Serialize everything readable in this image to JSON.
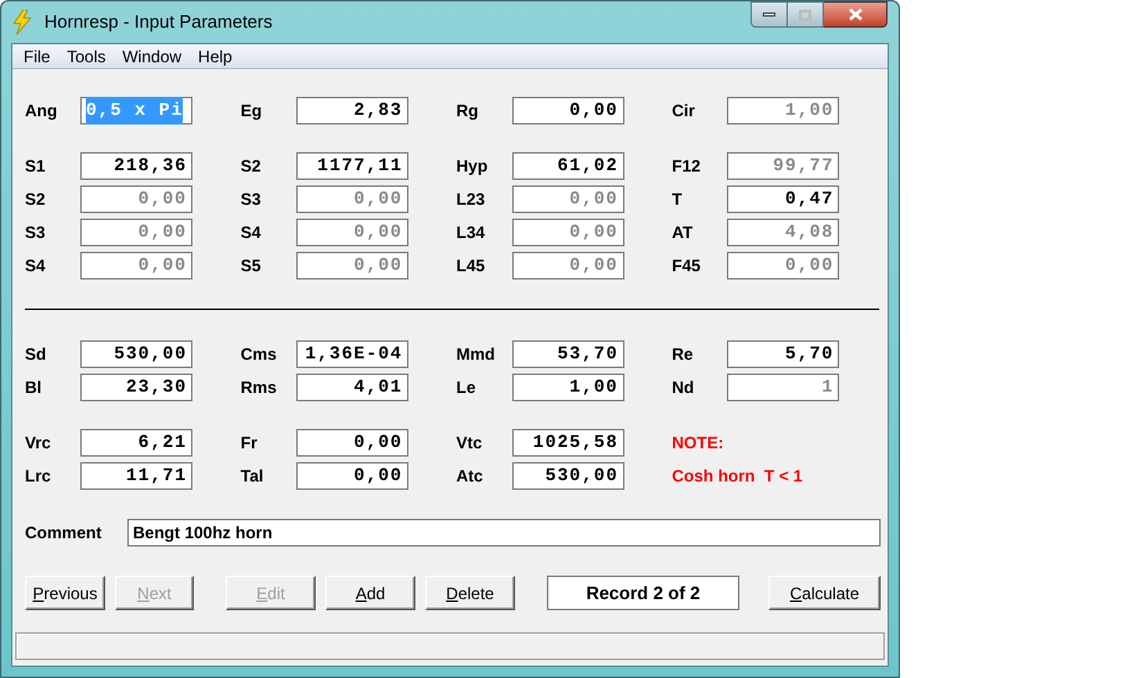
{
  "window": {
    "title": "Hornresp - Input Parameters"
  },
  "menu": [
    "File",
    "Tools",
    "Window",
    "Help"
  ],
  "blocks": [
    {
      "divider_before": false,
      "rows": [
        [
          {
            "kind": "field",
            "label": "Ang",
            "value": "0,5 x Pi",
            "disabled": false,
            "highlighted": true
          },
          {
            "kind": "field",
            "label": "Eg",
            "value": "2,83",
            "disabled": false,
            "highlighted": false
          },
          {
            "kind": "field",
            "label": "Rg",
            "value": "0,00",
            "disabled": false,
            "highlighted": false
          },
          {
            "kind": "field",
            "label": "Cir",
            "value": "1,00",
            "disabled": true,
            "highlighted": false
          }
        ]
      ]
    },
    {
      "divider_before": false,
      "rows": [
        [
          {
            "kind": "field",
            "label": "S1",
            "value": "218,36",
            "disabled": false,
            "highlighted": false
          },
          {
            "kind": "field",
            "label": "S2",
            "value": "1177,11",
            "disabled": false,
            "highlighted": false
          },
          {
            "kind": "field",
            "label": "Hyp",
            "value": "61,02",
            "disabled": false,
            "highlighted": false
          },
          {
            "kind": "field",
            "label": "F12",
            "value": "99,77",
            "disabled": true,
            "highlighted": false
          }
        ],
        [
          {
            "kind": "field",
            "label": "S2",
            "value": "0,00",
            "disabled": true,
            "highlighted": false
          },
          {
            "kind": "field",
            "label": "S3",
            "value": "0,00",
            "disabled": true,
            "highlighted": false
          },
          {
            "kind": "field",
            "label": "L23",
            "value": "0,00",
            "disabled": true,
            "highlighted": false
          },
          {
            "kind": "field",
            "label": "T",
            "value": "0,47",
            "disabled": false,
            "highlighted": false
          }
        ],
        [
          {
            "kind": "field",
            "label": "S3",
            "value": "0,00",
            "disabled": true,
            "highlighted": false
          },
          {
            "kind": "field",
            "label": "S4",
            "value": "0,00",
            "disabled": true,
            "highlighted": false
          },
          {
            "kind": "field",
            "label": "L34",
            "value": "0,00",
            "disabled": true,
            "highlighted": false
          },
          {
            "kind": "field",
            "label": "AT",
            "value": "4,08",
            "disabled": true,
            "highlighted": false
          }
        ],
        [
          {
            "kind": "field",
            "label": "S4",
            "value": "0,00",
            "disabled": true,
            "highlighted": false
          },
          {
            "kind": "field",
            "label": "S5",
            "value": "0,00",
            "disabled": true,
            "highlighted": false
          },
          {
            "kind": "field",
            "label": "L45",
            "value": "0,00",
            "disabled": true,
            "highlighted": false
          },
          {
            "kind": "field",
            "label": "F45",
            "value": "0,00",
            "disabled": true,
            "highlighted": false
          }
        ]
      ]
    },
    {
      "divider_before": true,
      "rows": [
        [
          {
            "kind": "field",
            "label": "Sd",
            "value": "530,00",
            "disabled": false,
            "highlighted": false
          },
          {
            "kind": "field",
            "label": "Cms",
            "value": "1,36E-04",
            "disabled": false,
            "highlighted": false
          },
          {
            "kind": "field",
            "label": "Mmd",
            "value": "53,70",
            "disabled": false,
            "highlighted": false
          },
          {
            "kind": "field",
            "label": "Re",
            "value": "5,70",
            "disabled": false,
            "highlighted": false
          }
        ],
        [
          {
            "kind": "field",
            "label": "Bl",
            "value": "23,30",
            "disabled": false,
            "highlighted": false
          },
          {
            "kind": "field",
            "label": "Rms",
            "value": "4,01",
            "disabled": false,
            "highlighted": false
          },
          {
            "kind": "field",
            "label": "Le",
            "value": "1,00",
            "disabled": false,
            "highlighted": false
          },
          {
            "kind": "field",
            "label": "Nd",
            "value": "1",
            "disabled": true,
            "highlighted": false
          }
        ]
      ]
    },
    {
      "divider_before": false,
      "rows": [
        [
          {
            "kind": "field",
            "label": "Vrc",
            "value": "6,21",
            "disabled": false,
            "highlighted": false
          },
          {
            "kind": "field",
            "label": "Fr",
            "value": "0,00",
            "disabled": false,
            "highlighted": false
          },
          {
            "kind": "field",
            "label": "Vtc",
            "value": "1025,58",
            "disabled": false,
            "highlighted": false
          },
          {
            "kind": "note",
            "label": "NOTE:"
          }
        ],
        [
          {
            "kind": "field",
            "label": "Lrc",
            "value": "11,71",
            "disabled": false,
            "highlighted": false
          },
          {
            "kind": "field",
            "label": "Tal",
            "value": "0,00",
            "disabled": false,
            "highlighted": false
          },
          {
            "kind": "field",
            "label": "Atc",
            "value": "530,00",
            "disabled": false,
            "highlighted": false
          },
          {
            "kind": "note",
            "label": "Cosh horn  T < 1"
          }
        ]
      ]
    }
  ],
  "comment": {
    "label": "Comment",
    "value": "Bengt 100hz horn"
  },
  "buttons": [
    {
      "kind": "button",
      "label": "Previous",
      "disabled": false
    },
    {
      "kind": "button",
      "label": "Next",
      "disabled": true
    },
    {
      "kind": "button",
      "label": "Edit",
      "disabled": true
    },
    {
      "kind": "button",
      "label": "Add",
      "disabled": false
    },
    {
      "kind": "button",
      "label": "Delete",
      "disabled": false
    },
    {
      "kind": "display",
      "label": "Record 2 of 2"
    },
    {
      "kind": "button",
      "label": "Calculate",
      "disabled": false
    }
  ]
}
